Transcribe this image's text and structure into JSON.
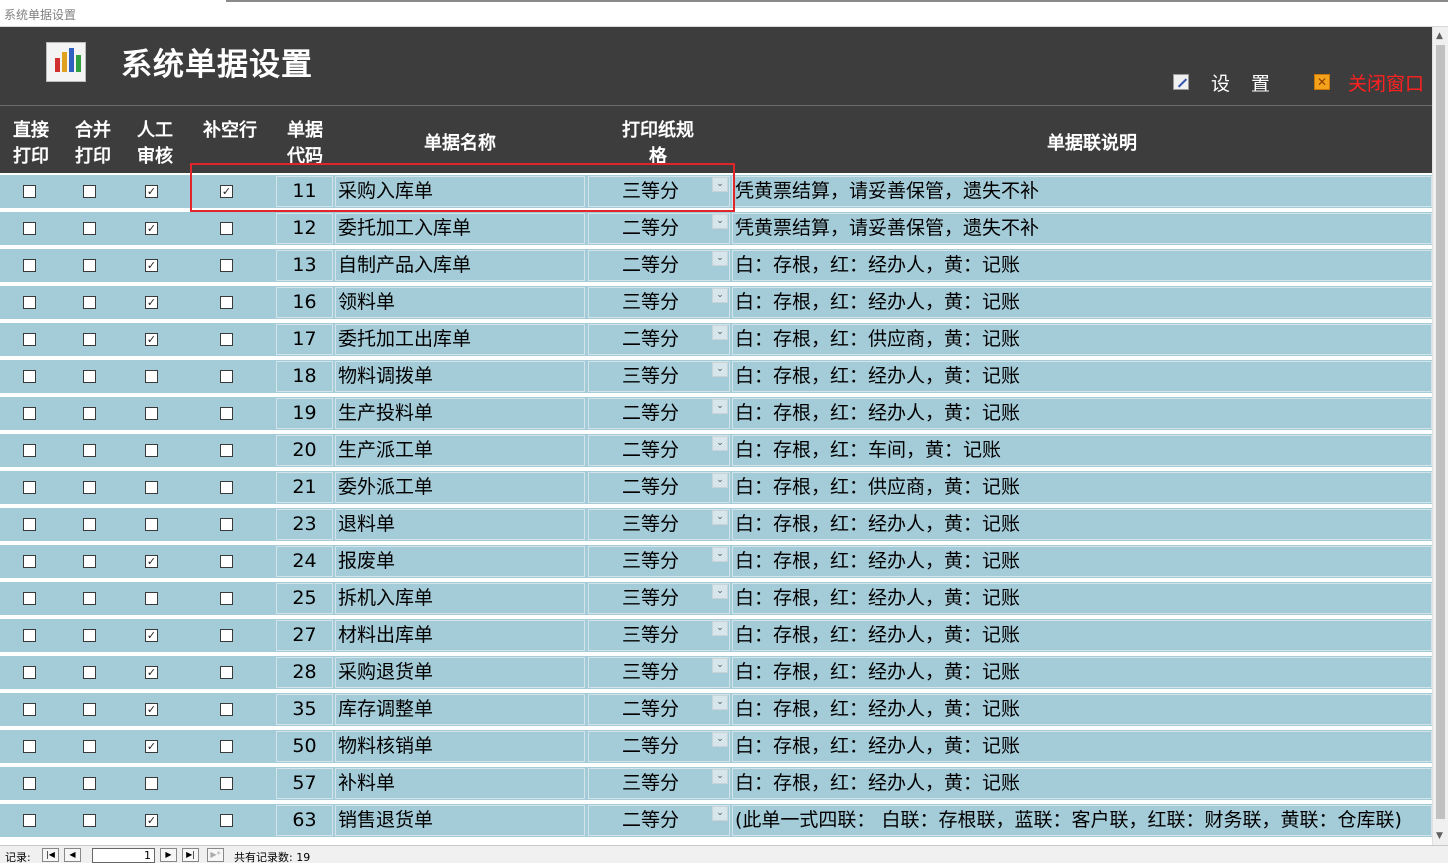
{
  "window": {
    "title": "系统单据设置"
  },
  "header": {
    "title": "系统单据设置",
    "settings_label": "设置",
    "close_label": "关闭窗口",
    "icons": {
      "app": "chart-report-icon",
      "settings": "edit-settings-icon",
      "close": "close-window-icon"
    }
  },
  "columns": {
    "direct_print": "直接打印",
    "merge_print": "合并打印",
    "manual_review": "人工审核",
    "fill_blank": "补空行",
    "code": "单据代码",
    "name": "单据名称",
    "paper": "打印纸规格",
    "desc": "单据联说明"
  },
  "rows": [
    {
      "direct_print": false,
      "merge_print": false,
      "manual_review": true,
      "fill_blank": true,
      "code": "11",
      "name": "采购入库单",
      "paper": "三等分",
      "desc": "凭黄票结算，请妥善保管，遗失不补"
    },
    {
      "direct_print": false,
      "merge_print": false,
      "manual_review": true,
      "fill_blank": false,
      "code": "12",
      "name": "委托加工入库单",
      "paper": "二等分",
      "desc": "凭黄票结算，请妥善保管，遗失不补"
    },
    {
      "direct_print": false,
      "merge_print": false,
      "manual_review": true,
      "fill_blank": false,
      "code": "13",
      "name": "自制产品入库单",
      "paper": "二等分",
      "desc": "白：存根，红：经办人，黄：记账"
    },
    {
      "direct_print": false,
      "merge_print": false,
      "manual_review": true,
      "fill_blank": false,
      "code": "16",
      "name": "领料单",
      "paper": "三等分",
      "desc": "白：存根，红：经办人，黄：记账"
    },
    {
      "direct_print": false,
      "merge_print": false,
      "manual_review": true,
      "fill_blank": false,
      "code": "17",
      "name": "委托加工出库单",
      "paper": "二等分",
      "desc": "白：存根，红：供应商，黄：记账"
    },
    {
      "direct_print": false,
      "merge_print": false,
      "manual_review": false,
      "fill_blank": false,
      "code": "18",
      "name": "物料调拨单",
      "paper": "三等分",
      "desc": "白：存根，红：经办人，黄：记账"
    },
    {
      "direct_print": false,
      "merge_print": false,
      "manual_review": false,
      "fill_blank": false,
      "code": "19",
      "name": "生产投料单",
      "paper": "二等分",
      "desc": "白：存根，红：经办人，黄：记账"
    },
    {
      "direct_print": false,
      "merge_print": false,
      "manual_review": false,
      "fill_blank": false,
      "code": "20",
      "name": "生产派工单",
      "paper": "二等分",
      "desc": "白：存根，红：车间，黄：记账"
    },
    {
      "direct_print": false,
      "merge_print": false,
      "manual_review": false,
      "fill_blank": false,
      "code": "21",
      "name": "委外派工单",
      "paper": "二等分",
      "desc": "白：存根，红：供应商，黄：记账"
    },
    {
      "direct_print": false,
      "merge_print": false,
      "manual_review": false,
      "fill_blank": false,
      "code": "23",
      "name": "退料单",
      "paper": "三等分",
      "desc": "白：存根，红：经办人，黄：记账"
    },
    {
      "direct_print": false,
      "merge_print": false,
      "manual_review": true,
      "fill_blank": false,
      "code": "24",
      "name": "报废单",
      "paper": "三等分",
      "desc": "白：存根，红：经办人，黄：记账"
    },
    {
      "direct_print": false,
      "merge_print": false,
      "manual_review": false,
      "fill_blank": false,
      "code": "25",
      "name": "拆机入库单",
      "paper": "三等分",
      "desc": "白：存根，红：经办人，黄：记账"
    },
    {
      "direct_print": false,
      "merge_print": false,
      "manual_review": true,
      "fill_blank": false,
      "code": "27",
      "name": "材料出库单",
      "paper": "三等分",
      "desc": "白：存根，红：经办人，黄：记账"
    },
    {
      "direct_print": false,
      "merge_print": false,
      "manual_review": true,
      "fill_blank": false,
      "code": "28",
      "name": "采购退货单",
      "paper": "三等分",
      "desc": "白：存根，红：经办人，黄：记账"
    },
    {
      "direct_print": false,
      "merge_print": false,
      "manual_review": true,
      "fill_blank": false,
      "code": "35",
      "name": "库存调整单",
      "paper": "二等分",
      "desc": "白：存根，红：经办人，黄：记账"
    },
    {
      "direct_print": false,
      "merge_print": false,
      "manual_review": true,
      "fill_blank": false,
      "code": "50",
      "name": "物料核销单",
      "paper": "二等分",
      "desc": "白：存根，红：经办人，黄：记账"
    },
    {
      "direct_print": false,
      "merge_print": false,
      "manual_review": false,
      "fill_blank": false,
      "code": "57",
      "name": "补料单",
      "paper": "三等分",
      "desc": "白：存根，红：经办人，黄：记账"
    },
    {
      "direct_print": false,
      "merge_print": false,
      "manual_review": true,
      "fill_blank": false,
      "code": "63",
      "name": "销售退货单",
      "paper": "二等分",
      "desc": " (此单一式四联：  白联：存根联，蓝联：客户联，红联：财务联，黄联：仓库联)"
    }
  ],
  "nav": {
    "label": "记录:",
    "current": "1",
    "count_text": "共有记录数: 19"
  }
}
